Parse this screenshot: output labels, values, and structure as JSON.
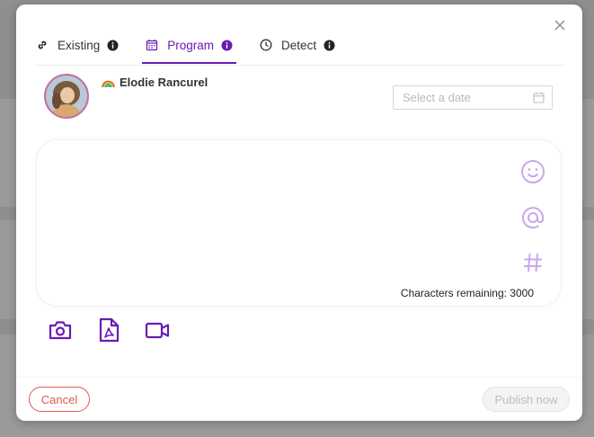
{
  "tabs": [
    {
      "label": "Existing",
      "icon": "link-icon",
      "active": false
    },
    {
      "label": "Program",
      "icon": "calendar-icon",
      "active": true
    },
    {
      "label": "Detect",
      "icon": "clock-icon",
      "active": false
    }
  ],
  "account": {
    "name": "Elodie Rancurel",
    "emoji": "rainbow-icon"
  },
  "date_picker": {
    "placeholder": "Select a date"
  },
  "editor": {
    "characters_remaining": "Characters remaining: 3000",
    "tools": [
      "emoji-icon",
      "mention-icon",
      "hashtag-icon"
    ]
  },
  "attachments": [
    "camera-icon",
    "pdf-icon",
    "video-icon"
  ],
  "footer": {
    "cancel_label": "Cancel",
    "publish_label": "Publish now"
  },
  "colors": {
    "accent": "#6a1bb5",
    "accent_light": "#c9a8ea",
    "danger": "#e05a4f"
  }
}
